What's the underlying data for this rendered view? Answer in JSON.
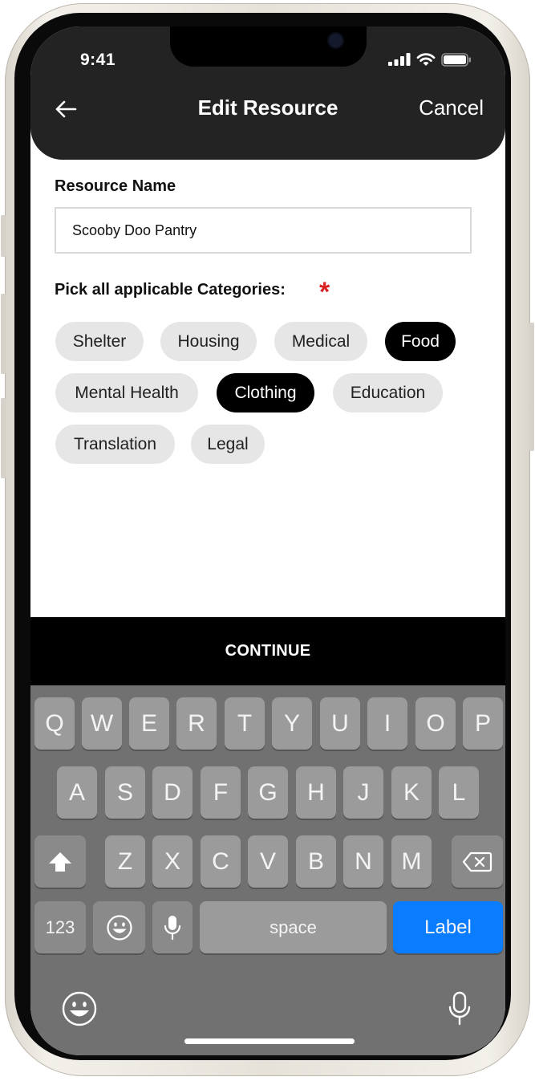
{
  "status_bar": {
    "time": "9:41"
  },
  "header": {
    "title": "Edit Resource",
    "cancel_label": "Cancel"
  },
  "form": {
    "resource_name_label": "Resource Name",
    "resource_name_value": "Scooby Doo Pantry",
    "categories_label": "Pick all applicable Categories:",
    "required_marker": "*"
  },
  "categories": [
    {
      "label": "Shelter",
      "selected": false
    },
    {
      "label": "Housing",
      "selected": false
    },
    {
      "label": "Medical",
      "selected": false
    },
    {
      "label": "Food",
      "selected": true
    },
    {
      "label": "Mental Health",
      "selected": false
    },
    {
      "label": "Clothing",
      "selected": true
    },
    {
      "label": "Education",
      "selected": false
    },
    {
      "label": "Translation",
      "selected": false
    },
    {
      "label": "Legal",
      "selected": false
    }
  ],
  "continue_label": "CONTINUE",
  "keyboard": {
    "row1": [
      "Q",
      "W",
      "E",
      "R",
      "T",
      "Y",
      "U",
      "I",
      "O",
      "P"
    ],
    "row2": [
      "A",
      "S",
      "D",
      "F",
      "G",
      "H",
      "J",
      "K",
      "L"
    ],
    "row3": [
      "Z",
      "X",
      "C",
      "V",
      "B",
      "N",
      "M"
    ],
    "numbers_label": "123",
    "space_label": "space",
    "return_label": "Label",
    "icons": {
      "shift": "shift-icon",
      "delete": "delete-icon",
      "emoji": "emoji-icon",
      "mic": "microphone-icon"
    }
  },
  "colors": {
    "header_bg": "#232323",
    "chip_bg": "#e6e6e6",
    "chip_selected_bg": "#000000",
    "required": "#d92323",
    "keyboard_bg": "#717171",
    "return_key": "#0a7cff"
  }
}
